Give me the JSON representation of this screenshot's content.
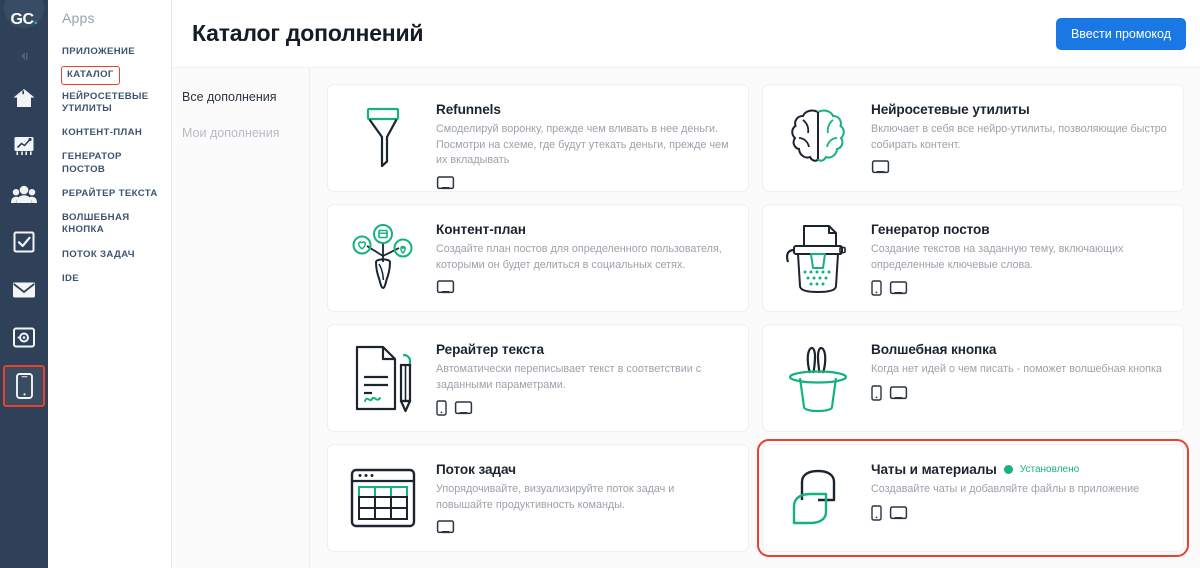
{
  "rail": {
    "logo_text": "GC",
    "logo_accent": ".",
    "items": [
      {
        "name": "collapse-icon",
        "label": "Свернуть"
      },
      {
        "name": "home-icon",
        "label": "Главная"
      },
      {
        "name": "analytics-icon",
        "label": "Аналитика"
      },
      {
        "name": "users-icon",
        "label": "Пользователи"
      },
      {
        "name": "tasks-icon",
        "label": "Задачи"
      },
      {
        "name": "mail-icon",
        "label": "Почта"
      },
      {
        "name": "safe-icon",
        "label": "Сейф"
      },
      {
        "name": "mobile-app-icon",
        "label": "Приложение"
      }
    ],
    "selected_index": 7,
    "highlight_color": "#e8412f",
    "background": "#2e4159"
  },
  "menu": {
    "title": "Apps",
    "items": [
      {
        "label": "ПРИЛОЖЕНИЕ",
        "selected": false
      },
      {
        "label": "КАТАЛОГ",
        "selected": true
      },
      {
        "label": "НЕЙРОСЕТЕВЫЕ УТИЛИТЫ",
        "selected": false
      },
      {
        "label": "КОНТЕНТ-ПЛАН",
        "selected": false
      },
      {
        "label": "ГЕНЕРАТОР ПОСТОВ",
        "selected": false
      },
      {
        "label": "РЕРАЙТЕР ТЕКСТА",
        "selected": false
      },
      {
        "label": "ВОЛШЕБНАЯ КНОПКА",
        "selected": false
      },
      {
        "label": "ПОТОК ЗАДАЧ",
        "selected": false
      },
      {
        "label": "IDE",
        "selected": false
      }
    ]
  },
  "header": {
    "title": "Каталог дополнений",
    "promo_button": "Ввести промокод",
    "promo_button_color": "#1a78e5"
  },
  "filters": [
    {
      "label": "Все дополнения",
      "active": true
    },
    {
      "label": "Мои дополнения",
      "active": false
    }
  ],
  "cards": [
    {
      "icon": "funnel-icon",
      "title": "Refunnels",
      "description": "Смоделируй воронку, прежде чем вливать в нее деньги. Посмотри на схеме, где будут утекать деньги, прежде чем их вкладывать",
      "platforms": [
        "laptop-icon"
      ],
      "status": null,
      "highlighted": false
    },
    {
      "icon": "brain-icon",
      "title": "Нейросетевые утилиты",
      "description": "Включает в себя все нейро-утилиты, позволяющие быстро собирать контент.",
      "platforms": [
        "laptop-icon"
      ],
      "status": null,
      "highlighted": false
    },
    {
      "icon": "content-plan-icon",
      "title": "Контент-план",
      "description": "Создайте план постов для определенного пользователя, которыми он будет делиться в социальных сетях.",
      "platforms": [
        "laptop-icon"
      ],
      "status": null,
      "highlighted": false
    },
    {
      "icon": "post-generator-icon",
      "title": "Генератор постов",
      "description": "Создание текстов на заданную тему, включающих определенные ключевые слова.",
      "platforms": [
        "phone-icon",
        "laptop-icon"
      ],
      "status": null,
      "highlighted": false
    },
    {
      "icon": "text-rewriter-icon",
      "title": "Рерайтер текста",
      "description": "Автоматически переписывает текст в соответствии с заданными параметрами.",
      "platforms": [
        "phone-icon",
        "laptop-icon"
      ],
      "status": null,
      "highlighted": false
    },
    {
      "icon": "magic-hat-icon",
      "title": "Волшебная кнопка",
      "description": "Когда нет идей о чем писать - поможет волшебная кнопка",
      "platforms": [
        "phone-icon",
        "laptop-icon"
      ],
      "status": null,
      "highlighted": false
    },
    {
      "icon": "task-flow-icon",
      "title": "Поток задач",
      "description": "Упорядочивайте, визуализируйте поток задач и повышайте продуктивность команды.",
      "platforms": [
        "laptop-icon"
      ],
      "status": null,
      "highlighted": false
    },
    {
      "icon": "chats-icon",
      "title": "Чаты и материалы",
      "description": "Создавайте чаты и добавляйте файлы в приложение",
      "platforms": [
        "phone-icon",
        "laptop-icon"
      ],
      "status": "Установлено",
      "highlighted": true
    }
  ],
  "colors": {
    "accent_teal": "#14b37d",
    "dark_ink": "#1c2430",
    "highlight_red": "#e8412f",
    "rail_bg": "#2e4159",
    "page_bg": "#fbfbfb"
  }
}
